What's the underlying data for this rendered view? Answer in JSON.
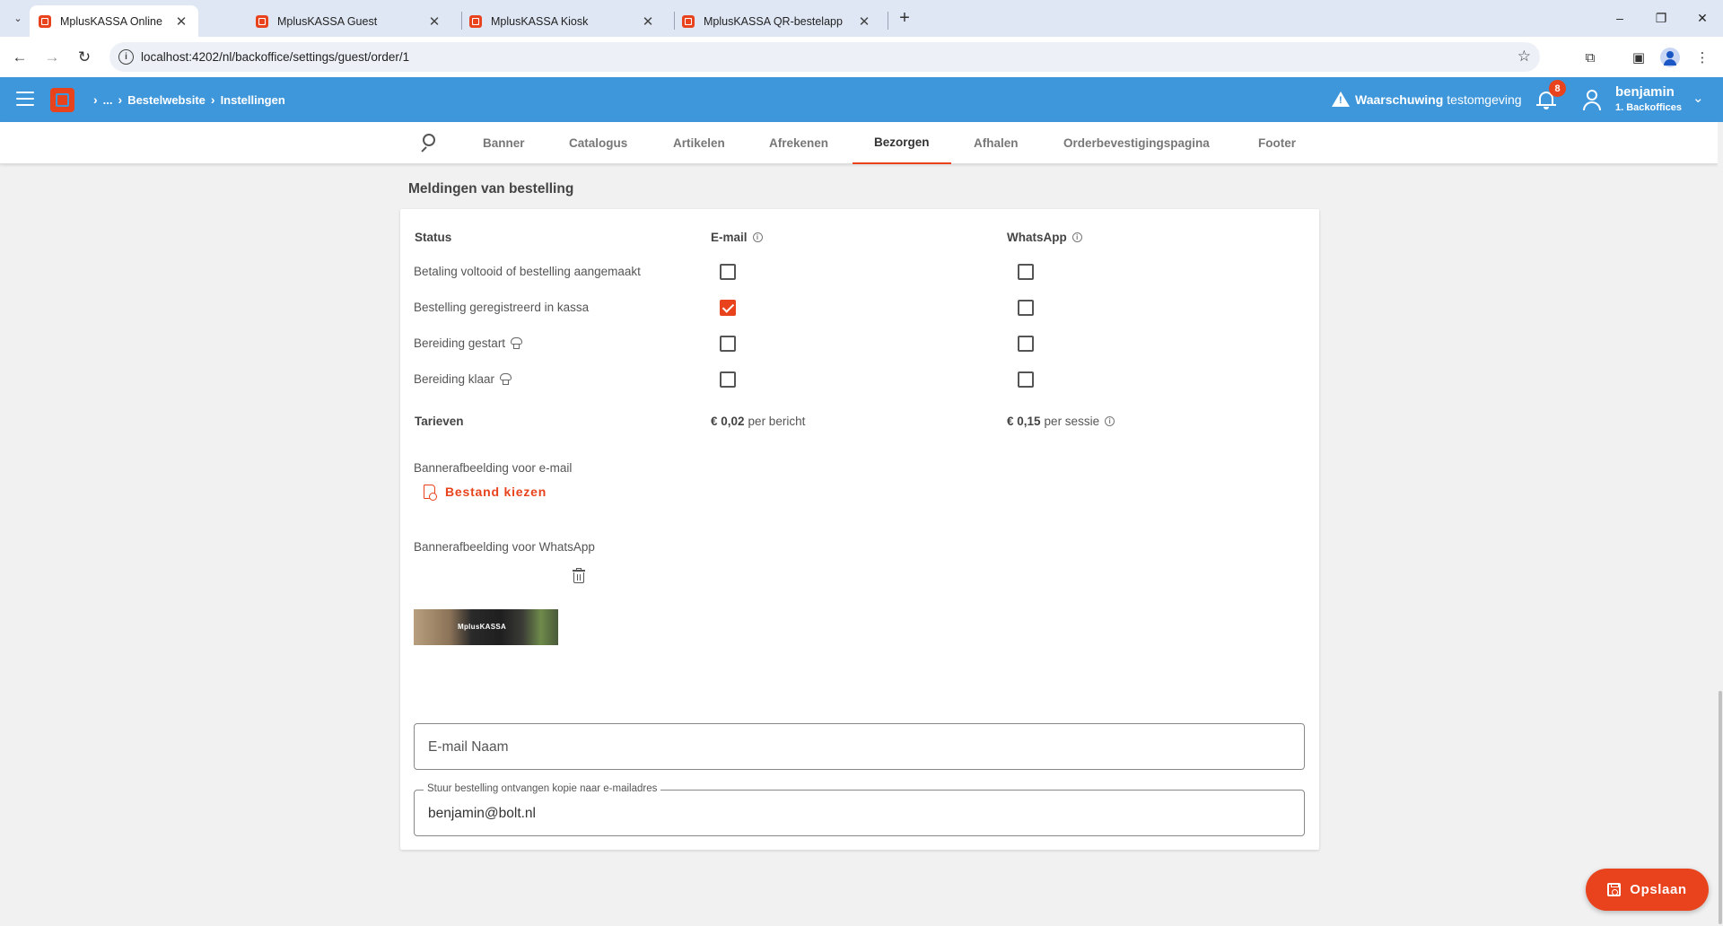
{
  "browser": {
    "tabs": [
      {
        "label": "MplusKASSA Online",
        "active": true
      },
      {
        "label": "MplusKASSA Guest",
        "active": false
      },
      {
        "label": "MplusKASSA Kiosk",
        "active": false
      },
      {
        "label": "MplusKASSA QR-bestelapp",
        "active": false
      }
    ],
    "new_tab": "+",
    "url": "localhost:4202/nl/backoffice/settings/guest/order/1",
    "controls": {
      "minimize": "–",
      "restore": "❐",
      "close": "✕",
      "back": "←",
      "forward": "→",
      "reload": "↻",
      "bookmark": "☆",
      "extensions": "⧉",
      "sidepanel": "▣",
      "menu": "⋮"
    }
  },
  "header": {
    "breadcrumbs": [
      "...",
      "Bestelwebsite",
      "Instellingen"
    ],
    "warning_bold": "Waarschuwing",
    "warning_text": "testomgeving",
    "notification_count": "8",
    "user_name": "benjamin",
    "user_role": "1. Backoffices",
    "accent_color": "#3f97db"
  },
  "section_tabs": [
    "Banner",
    "Catalogus",
    "Artikelen",
    "Afrekenen",
    "Bezorgen",
    "Afhalen",
    "Orderbevestigingspagina",
    "Footer"
  ],
  "active_tab": "Bezorgen",
  "notifications": {
    "title": "Meldingen van bestelling",
    "col_status": "Status",
    "col_email": "E-mail",
    "col_whatsapp": "WhatsApp",
    "rows": [
      {
        "label": "Betaling voltooid of bestelling aangemaakt",
        "email": false,
        "whatsapp": false,
        "chef": false
      },
      {
        "label": "Bestelling geregistreerd in kassa",
        "email": true,
        "whatsapp": false,
        "chef": false
      },
      {
        "label": "Bereiding gestart",
        "email": false,
        "whatsapp": false,
        "chef": true
      },
      {
        "label": "Bereiding klaar",
        "email": false,
        "whatsapp": false,
        "chef": true
      }
    ],
    "rates_label": "Tarieven",
    "email_rate_value": "€ 0,02",
    "email_rate_unit": "per bericht",
    "whatsapp_rate_value": "€ 0,15",
    "whatsapp_rate_unit": "per sessie",
    "email_banner_label": "Bannerafbeelding voor e-mail",
    "choose_file": "Bestand kiezen",
    "whatsapp_banner_label": "Bannerafbeelding voor WhatsApp",
    "banner_logo_text": "MplusKASSA",
    "email_name_placeholder": "E-mail Naam",
    "copy_label": "Stuur bestelling ontvangen kopie naar e-mailadres",
    "copy_value": "benjamin@bolt.nl"
  },
  "save_label": "Opslaan",
  "brand_color": "#e8431c"
}
